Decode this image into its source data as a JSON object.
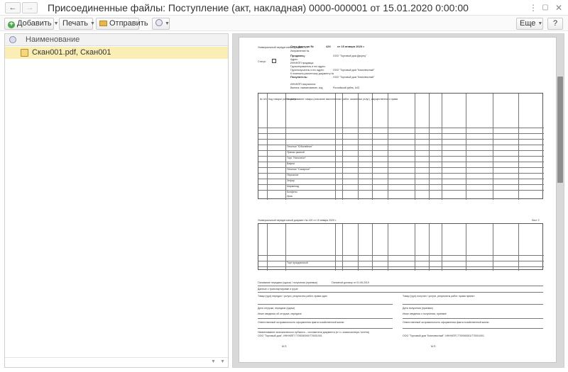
{
  "window": {
    "title": "Присоединенные файлы: Поступление (акт, накладная) 0000-000001 от 15.01.2020 0:00:00",
    "back_glyph": "←",
    "forward_glyph": "→",
    "more_glyph": "⋮",
    "maximize_glyph": "▢",
    "close_glyph": "✕"
  },
  "toolbar": {
    "add_label": "Добавить",
    "print_label": "Печать",
    "send_label": "Отправить",
    "more_label": "Еще",
    "help_label": "?"
  },
  "list": {
    "column_header": "Наименование",
    "rows": [
      {
        "label": "Скан001.pdf, Скан001"
      }
    ]
  },
  "document": {
    "header_left": "Универсальный передаточный документ",
    "invoice_label": "Счет-фактура №",
    "invoice_number": "420",
    "invoice_date": "от 15 января 2020 г.",
    "correction_label": "Исправление №",
    "status_label": "Статус:",
    "status_value": "1",
    "seller_label": "Продавец:",
    "seller_value": "ООО \"Торговый дом Дворец\"",
    "address_label": "Адрес:",
    "inn_label": "ИНН/КПП продавца:",
    "shipper_label": "Грузоотправитель и его адрес:",
    "consignee_label": "Грузополучатель и его адрес:",
    "consignee_value": "ООО \"Торговый дом \"Комплексный\"",
    "payment_doc_label": "К платежно-расчетному документу №",
    "buyer_label": "Покупатель:",
    "buyer_value": "ООО \"Торговый дом \"Комплексный\"",
    "buyer_inn_label": "ИНН/КПП покупателя:",
    "currency_label": "Валюта: наименование, код",
    "currency_value": "Российский рубль, 643",
    "col_headers": [
      "№ п/п",
      "Код товара/ работ, услуг",
      "Наименование товара (описание выполненных работ, оказанных услуг), имущественного права",
      "Единица измерения",
      "Коли-чество (объем)",
      "Цена (тариф) за единицу измерения",
      "Стоимость товаров (работ, услуг), имущественных прав без налога - всего",
      "В том числе сумма акциза",
      "Нало-говая ставка",
      "Сумма налога, предъявляемая покупателю",
      "Стоимость товаров (работ, услуг), имущественных прав с налогом - всего",
      "Страна происхождения товара",
      "Номер таможенной декларации"
    ],
    "items": [
      "Печенье \"Юбилейное\"",
      "Пряник ржаной",
      "Торт \"Наполеон\"",
      "Вафли",
      "Печенье \"Сахарное\"",
      "Пирожное",
      "Зефир",
      "Мармелад",
      "Конфеты",
      "Ирис"
    ],
    "page2_header": "Универсальный передаточный документ № 420 от 15 января 2020 г.",
    "page2_item": "Торт праздничный",
    "page2_sheet": "Лист 2",
    "basis_label": "Основание передачи (сдачи) / получения (приемки)",
    "basis_value": "Основной договор от 01.06.2019",
    "transport_label": "Данные о транспортировке и грузе",
    "handed_label": "Товар (груз) передал / услуги, результаты работ, права сдал",
    "received_label": "Товар (груз) получил / услуги, результаты работ, права принял",
    "ship_date_label": "Дата отгрузки, передачи (сдачи)",
    "recv_date_label": "Дата получения (приемки)",
    "other_info_label": "Иные сведения об отгрузке, передаче",
    "other_recv_label": "Иные сведения о получении, приемке",
    "responsible_label": "Ответственный за правильность оформления факта хозяйственной жизни",
    "entity_label": "Наименование экономического субъекта – составителя документа (в т.ч. комиссионера / агента)",
    "entity_seller": "ООО \"Торговый дом\", ИНН/КПП 7700000000/770001001",
    "entity_buyer": "ООО \"Торговый дом \"Комплексный\", ИНН/КПП 7700000001/770001001",
    "mp_label": "М.П."
  }
}
